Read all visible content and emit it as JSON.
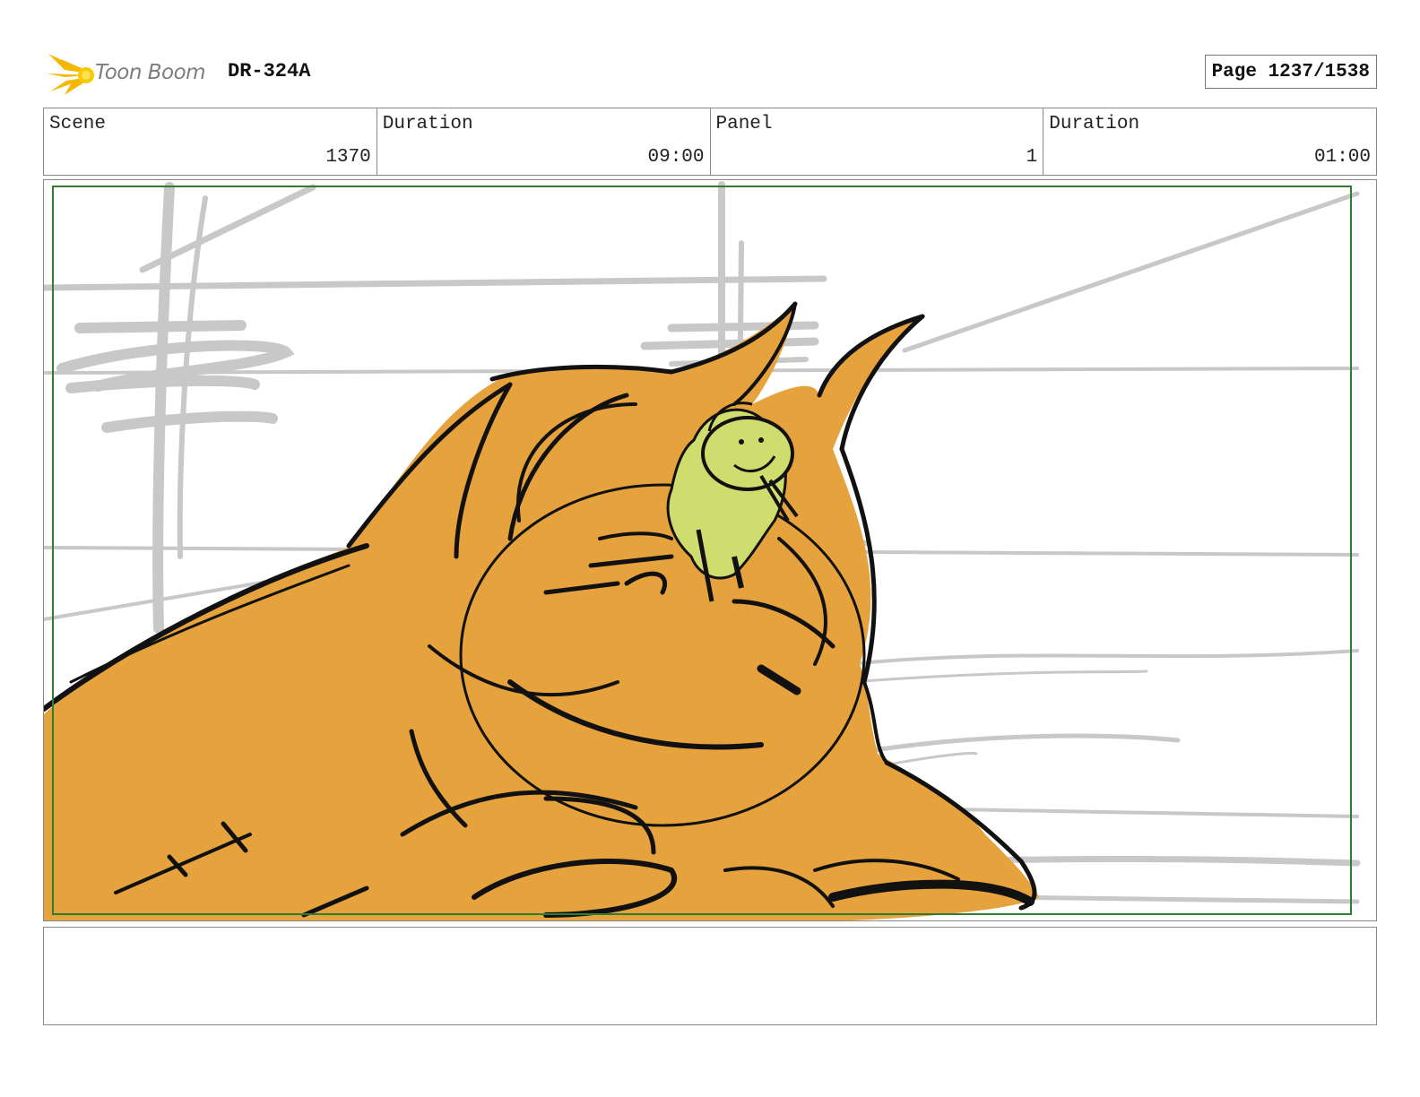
{
  "header": {
    "logo_text": "Toon Boom",
    "production_code": "DR-324A",
    "page_label": "Page 1237/1538"
  },
  "info": {
    "scene_label": "Scene",
    "scene_value": "1370",
    "scene_duration_label": "Duration",
    "scene_duration_value": "09:00",
    "panel_label": "Panel",
    "panel_value": "1",
    "panel_duration_label": "Duration",
    "panel_duration_value": "01:00"
  },
  "panel": {
    "safe_frame_color": "#2e7d32",
    "creature_color": "#e6a23c",
    "rider_color": "#cfdc6e",
    "sketch_gray": "#c8c8c8"
  },
  "notes": {
    "text": ""
  }
}
